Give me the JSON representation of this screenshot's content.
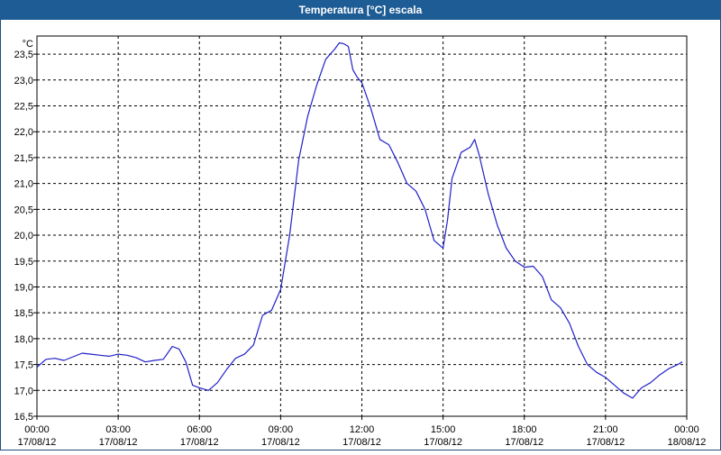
{
  "window": {
    "title": "Temperatura [°C] escala"
  },
  "colors": {
    "title_bar": "#1d5c94",
    "line": "#2020c8",
    "grid": "#000000"
  },
  "chart_data": {
    "type": "line",
    "title": "Temperatura [°C] escala",
    "ylabel": "°C",
    "ylim": [
      16.5,
      23.85
    ],
    "grid": true,
    "yticks": [
      "16,5",
      "17,0",
      "17,5",
      "18,0",
      "18,5",
      "19,0",
      "19,5",
      "20,0",
      "20,5",
      "21,0",
      "21,5",
      "22,0",
      "22,5",
      "23,0",
      "23,5"
    ],
    "xticks": [
      {
        "time": "00:00",
        "date": "17/08/12"
      },
      {
        "time": "03:00",
        "date": "17/08/12"
      },
      {
        "time": "06:00",
        "date": "17/08/12"
      },
      {
        "time": "09:00",
        "date": "17/08/12"
      },
      {
        "time": "12:00",
        "date": "17/08/12"
      },
      {
        "time": "15:00",
        "date": "17/08/12"
      },
      {
        "time": "18:00",
        "date": "17/08/12"
      },
      {
        "time": "21:00",
        "date": "17/08/12"
      },
      {
        "time": "00:00",
        "date": "18/08/12"
      }
    ],
    "series": [
      {
        "x": [
          "00:00",
          "00:20",
          "00:40",
          "01:00",
          "01:20",
          "01:40",
          "02:00",
          "02:20",
          "02:40",
          "03:00",
          "03:20",
          "03:40",
          "04:00",
          "04:20",
          "04:40",
          "05:00",
          "05:15",
          "05:30",
          "05:45",
          "06:00",
          "06:20",
          "06:40",
          "07:00",
          "07:20",
          "07:40",
          "08:00",
          "08:20",
          "08:40",
          "09:00",
          "09:20",
          "09:40",
          "10:00",
          "10:20",
          "10:40",
          "11:00",
          "11:10",
          "11:20",
          "11:30",
          "11:40",
          "11:50",
          "12:00",
          "12:20",
          "12:40",
          "13:00",
          "13:20",
          "13:40",
          "14:00",
          "14:20",
          "14:40",
          "15:00",
          "15:10",
          "15:20",
          "15:40",
          "16:00",
          "16:10",
          "16:20",
          "16:40",
          "17:00",
          "17:20",
          "17:40",
          "18:00",
          "18:20",
          "18:40",
          "19:00",
          "19:20",
          "19:40",
          "20:00",
          "20:20",
          "20:40",
          "21:00",
          "21:20",
          "21:40",
          "22:00",
          "22:20",
          "22:40",
          "23:00",
          "23:20",
          "23:40",
          "23:50"
        ],
        "values": [
          17.45,
          17.6,
          17.62,
          17.58,
          17.65,
          17.72,
          17.7,
          17.68,
          17.66,
          17.7,
          17.68,
          17.63,
          17.55,
          17.58,
          17.6,
          17.85,
          17.8,
          17.55,
          17.1,
          17.05,
          17.0,
          17.15,
          17.4,
          17.62,
          17.7,
          17.88,
          18.45,
          18.55,
          18.95,
          20.0,
          21.45,
          22.3,
          22.9,
          23.4,
          23.6,
          23.72,
          23.7,
          23.65,
          23.2,
          23.05,
          22.95,
          22.45,
          21.85,
          21.75,
          21.4,
          21.0,
          20.85,
          20.5,
          19.9,
          19.75,
          20.3,
          21.1,
          21.6,
          21.7,
          21.85,
          21.55,
          20.8,
          20.2,
          19.75,
          19.5,
          19.38,
          19.4,
          19.2,
          18.75,
          18.6,
          18.3,
          17.85,
          17.5,
          17.35,
          17.25,
          17.1,
          16.95,
          16.85,
          17.05,
          17.15,
          17.3,
          17.42,
          17.5,
          17.55
        ]
      }
    ]
  }
}
